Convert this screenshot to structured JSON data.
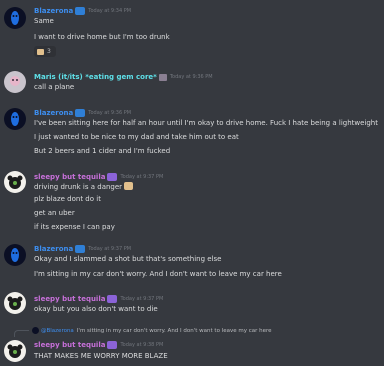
{
  "messages": [
    {
      "user": "Blazerona",
      "time": "Today at 9:34 PM",
      "lines": [
        "Same",
        "I want to drive home but I'm too drunk"
      ],
      "reaction": {
        "count": "3"
      }
    },
    {
      "user": "Maris (it/its) *eating gem core*",
      "time": "Today at 9:36 PM",
      "lines": [
        "call a plane"
      ]
    },
    {
      "user": "Blazerona",
      "time": "Today at 9:36 PM",
      "lines": [
        "I've been sitting here for half an hour until I'm okay to drive home. Fuck I hate being a lightweight",
        "I just wanted to be nice to my dad and take him out to eat",
        "But 2 beers and 1 cider and I'm fucked"
      ]
    },
    {
      "user": "sleepy but tequila",
      "time": "Today at 9:37 PM",
      "lines": [
        "driving drunk is a danger",
        "plz blaze dont do it",
        "get an uber",
        "if its expense I can pay"
      ]
    },
    {
      "user": "Blazerona",
      "time": "Today at 9:37 PM",
      "lines": [
        "Okay and I slammed a shot but that's something else",
        "I'm sitting in my car don't worry. And I don't want to leave my car here"
      ]
    },
    {
      "user": "sleepy but tequila",
      "time": "Today at 9:37 PM",
      "lines": [
        "okay but you also don't want to die"
      ]
    },
    {
      "reply": {
        "user": "@Blazerona",
        "text": "I'm sitting in my car don't worry. And I don't want to leave my car here"
      },
      "user": "sleepy but tequila",
      "time": "Today at 9:38 PM",
      "lines": [
        "THAT MAKES ME WORRY MORE BLAZE"
      ]
    }
  ]
}
